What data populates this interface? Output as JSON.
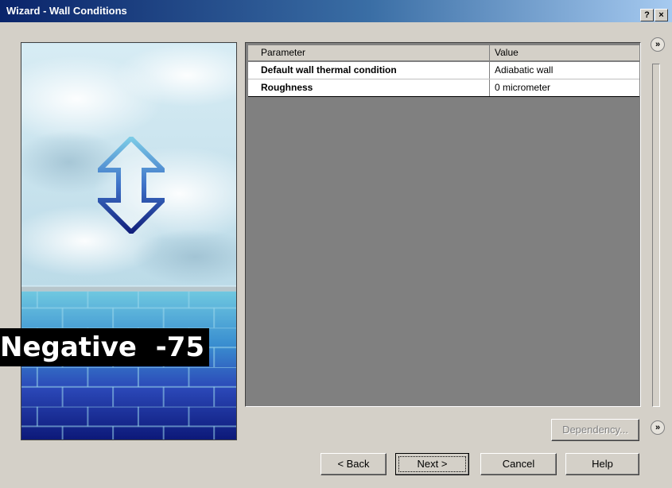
{
  "window": {
    "title": "Wizard - Wall Conditions",
    "help_glyph": "?",
    "close_glyph": "×"
  },
  "table": {
    "headers": {
      "parameter": "Parameter",
      "value": "Value"
    },
    "rows": [
      {
        "parameter": "Default wall thermal condition",
        "value": "Adiabatic wall"
      },
      {
        "parameter": "Roughness",
        "value": "0 micrometer"
      }
    ]
  },
  "overlay": {
    "label": "Negative  -75"
  },
  "side_buttons": {
    "expand_top": "»",
    "expand_bottom": "»"
  },
  "buttons": {
    "dependency": "Dependency...",
    "back": "< Back",
    "next": "Next >",
    "cancel": "Cancel",
    "help": "Help"
  },
  "icons": {
    "illustration": "wall-sky-illustration",
    "arrow": "up-down-arrow-icon"
  }
}
